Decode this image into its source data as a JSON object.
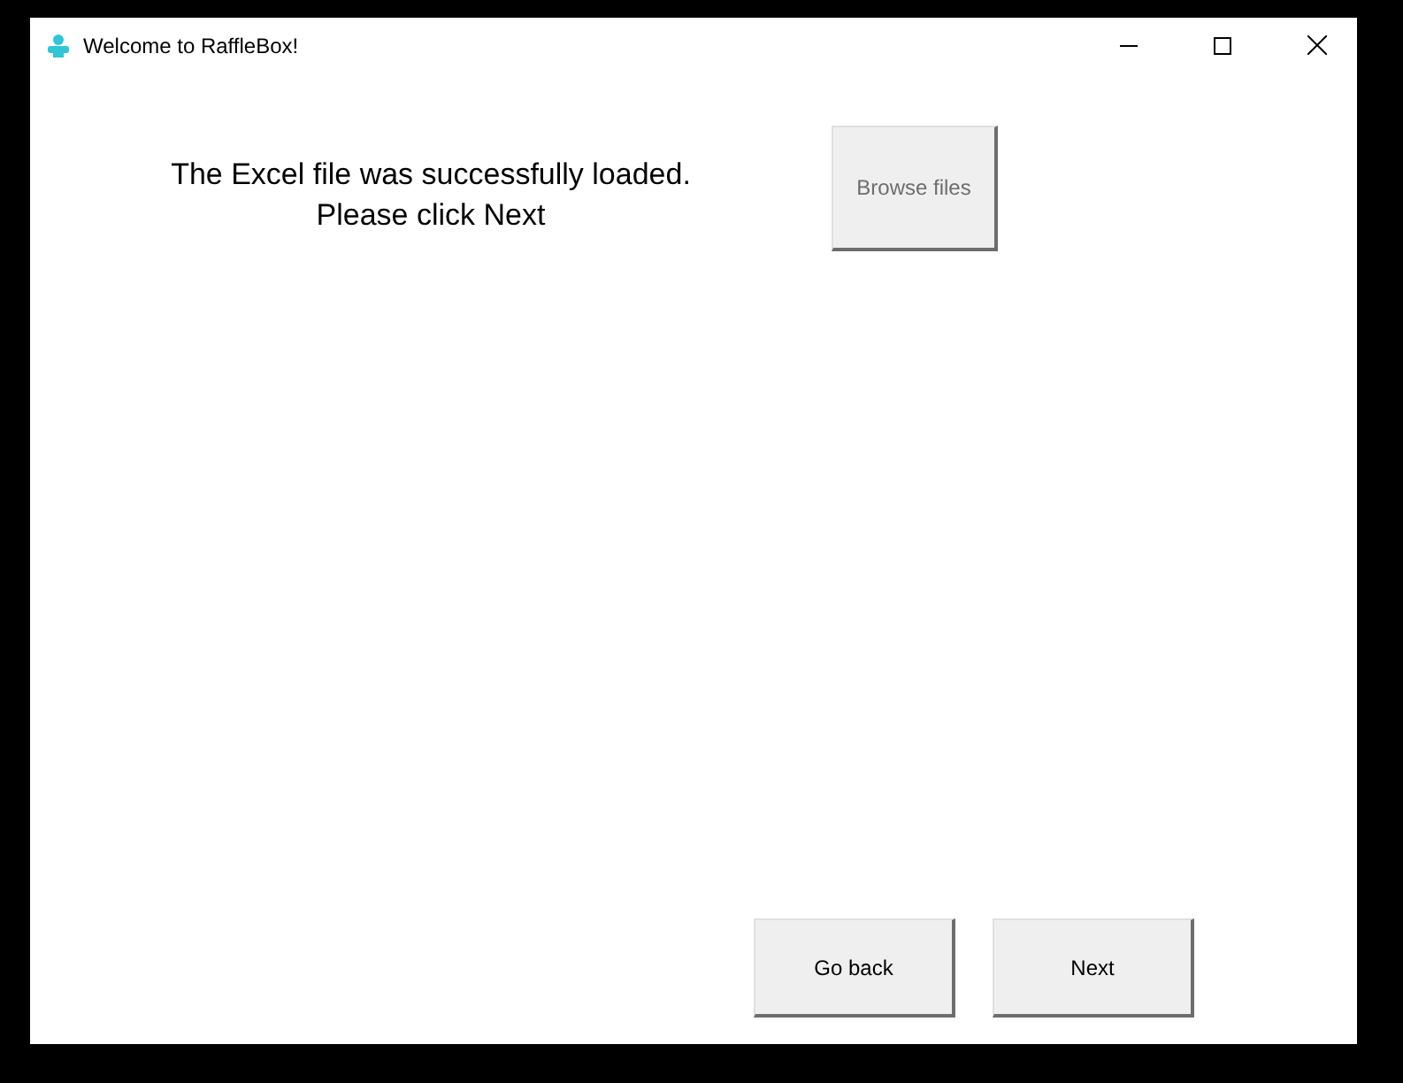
{
  "window": {
    "title": "Welcome to RaffleBox!"
  },
  "message": [
    "The Excel file was successfully loaded.",
    "Please click Next"
  ],
  "browse_button": {
    "label": "Browse files",
    "disabled": true
  },
  "buttons": [
    {
      "label": "Go back",
      "disabled": false
    },
    {
      "label": "Next",
      "disabled": false
    }
  ]
}
